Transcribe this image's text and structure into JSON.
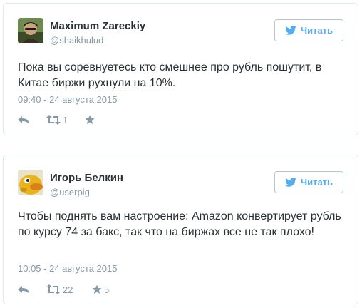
{
  "tweets": [
    {
      "name": "Maximum Zareckiy",
      "handle": "@shaikhulud",
      "follow_label": "Читать",
      "text": "Пока вы соревнуетесь кто смешнее про рубль пошутит, в Китае биржи рухнули на 10%.",
      "timestamp": "09:40 - 24 августа 2015",
      "retweets": "1",
      "likes": ""
    },
    {
      "name": "Игорь Белкин",
      "handle": "@userpig",
      "follow_label": "Читать",
      "text": "Чтобы поднять вам настроение: Amazon конвертирует рубль по курсу 74 за бакс, так что на биржах все не так плохо!",
      "timestamp": "10:05 - 24 августа 2015",
      "retweets": "22",
      "likes": "5"
    }
  ],
  "colors": {
    "accent": "#55acee",
    "text": "#292f33",
    "muted": "#8899a6",
    "border": "#e1e8ed"
  },
  "icons": [
    "twitter-bird-icon",
    "reply-icon",
    "retweet-icon",
    "star-icon"
  ]
}
